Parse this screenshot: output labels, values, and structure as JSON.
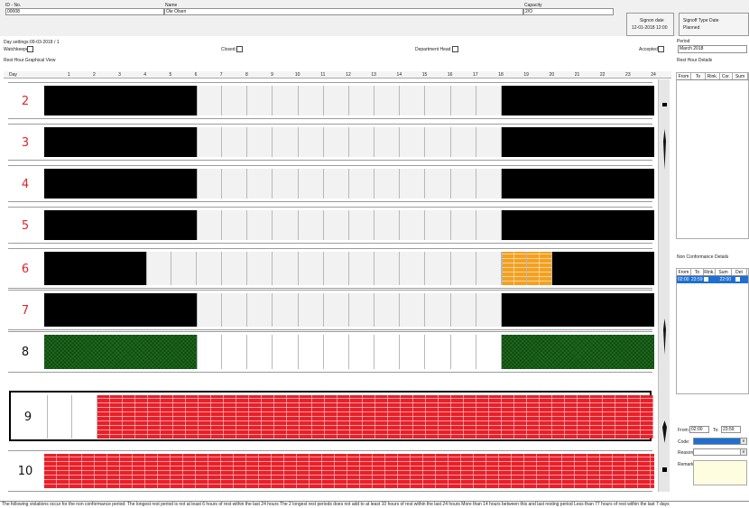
{
  "header": {
    "id_label": "ID - No.",
    "id_value": "00008",
    "name_label": "Name",
    "name_value": "Ole Olsen",
    "capacity_label": "Capacity",
    "capacity_value": "2/O",
    "signon_label": "Signon date",
    "signon_value": "12-01-2018 12:00",
    "signoff_type_label": "Signoff Type",
    "signoff_type_value": "Planned",
    "signoff_date_label": "Date"
  },
  "day_settings": {
    "label": "Day settings:",
    "value": "09-03-2018 / 1",
    "watchkeeper_label": "Watchkeeper:",
    "closed_label": "Closed:",
    "department_head_label": "Department Head",
    "accepted_label": "Accepted:"
  },
  "period": {
    "label": "Period",
    "value": "March 2018"
  },
  "graph": {
    "title": "Rest Hour Graphical View",
    "day_header": "Day",
    "hours": [
      "1",
      "2",
      "3",
      "4",
      "5",
      "6",
      "7",
      "8",
      "9",
      "10",
      "11",
      "12",
      "13",
      "14",
      "15",
      "16",
      "17",
      "18",
      "19",
      "20",
      "21",
      "22",
      "23",
      "24"
    ],
    "days": [
      {
        "label": "2",
        "color": "#e0242a"
      },
      {
        "label": "3",
        "color": "#e0242a"
      },
      {
        "label": "4",
        "color": "#e0242a"
      },
      {
        "label": "5",
        "color": "#e0242a"
      },
      {
        "label": "6",
        "color": "#e0242a"
      },
      {
        "label": "7",
        "color": "#e0242a"
      },
      {
        "label": "8",
        "color": "#111111"
      },
      {
        "label": "9",
        "color": "#111111"
      },
      {
        "label": "10",
        "color": "#111111"
      }
    ]
  },
  "rest_hour_details": {
    "title": "Rest Hour Details",
    "columns": [
      "From",
      "To",
      "Rink.",
      "Cor.",
      "Sum"
    ]
  },
  "non_conformance": {
    "title": "Non Conformance Details",
    "columns": [
      "From",
      "To",
      "Rink.",
      "Sum",
      "Det"
    ],
    "rows": [
      {
        "from": "02:00",
        "to": "23:59",
        "sum": "22:00"
      }
    ]
  },
  "edit": {
    "from_label": "From:",
    "from_value": "02:00",
    "to_label": "To:",
    "to_value": "23:59",
    "code_label": "Code:",
    "reason_label": "Reason:",
    "remark_label": "Remark:"
  },
  "status_text": "The following violations occur for the non conformance period: The longest rest period is not at least 6 hours of rest within the last 24 hours The 2 longest rest periods does not add to at least 10 hours of rest within the last 24 hours More than 14 hours between this and last resting period Less than 77 hours of rest within the last 7 days",
  "colors": {
    "rest": "#000000",
    "work": "#f2f2f2",
    "planned": "#1c6b1c",
    "violation": "#e8202a",
    "nc": "#f4a020"
  }
}
